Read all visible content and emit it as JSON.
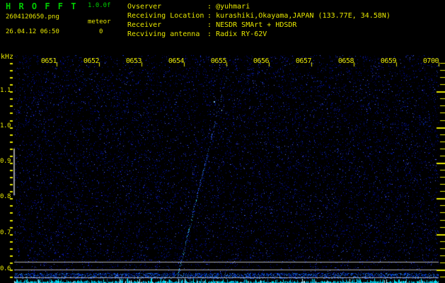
{
  "header": {
    "app_title": "H R O F F T",
    "version": "1.0.0f",
    "filename": "2604120650.png",
    "meteor_label": "meteor",
    "meteor_count": "0",
    "datetime": "26.04.12 06:50",
    "colon": ":",
    "info": [
      {
        "label": "Ovserver",
        "value": "@yuhmari"
      },
      {
        "label": "Receiving Location",
        "value": "kurashiki,Okayama,JAPAN (133.77E, 34.58N)"
      },
      {
        "label": "Receiver",
        "value": "NESDR SMArt + HDSDR"
      },
      {
        "label": "Recviving antenna",
        "value": "Radix RY-62V"
      }
    ]
  },
  "axis": {
    "freq_unit": "kHz",
    "time_labels": [
      "0651",
      "0652",
      "0653",
      "0654",
      "0655",
      "0656",
      "0657",
      "0658",
      "0659",
      "0700"
    ],
    "freq_labels": [
      "1.1",
      "1.0",
      "0.9",
      "0.8",
      "0.7",
      "0.6"
    ]
  },
  "colors": {
    "text_yellow": "#e6e600",
    "title_green": "#00cc00",
    "noise_blue": "#0000c8",
    "carrier_gray": "#b0b0b0",
    "signal_cyan": "#00e0f0",
    "background": "#000000"
  },
  "chart_data": {
    "type": "heatmap",
    "ylabel": "kHz",
    "x_tick_labels": [
      "0651",
      "0652",
      "0653",
      "0654",
      "0655",
      "0656",
      "0657",
      "0658",
      "0659",
      "0700"
    ],
    "y_tick_values_khz": [
      1.1,
      1.0,
      0.9,
      0.8,
      0.7,
      0.6
    ],
    "y_minor_tick_step_khz": 0.02,
    "ylim_khz": [
      0.56,
      1.2
    ],
    "x_span_minutes": 10,
    "meteor_echo_count": 0,
    "carrier_lines_khz": [
      0.62,
      0.6,
      0.58
    ],
    "drifting_tone": {
      "from": {
        "time": "0653:50",
        "khz": 0.58
      },
      "to": {
        "time": "0655:00",
        "khz": 1.16
      }
    },
    "left_scale_bar_khz": [
      0.81,
      0.94
    ],
    "background_texture": "sparse dark-blue receiver noise",
    "bottom_trace": "cyan jagged received-signal-level line along bottom edge"
  }
}
